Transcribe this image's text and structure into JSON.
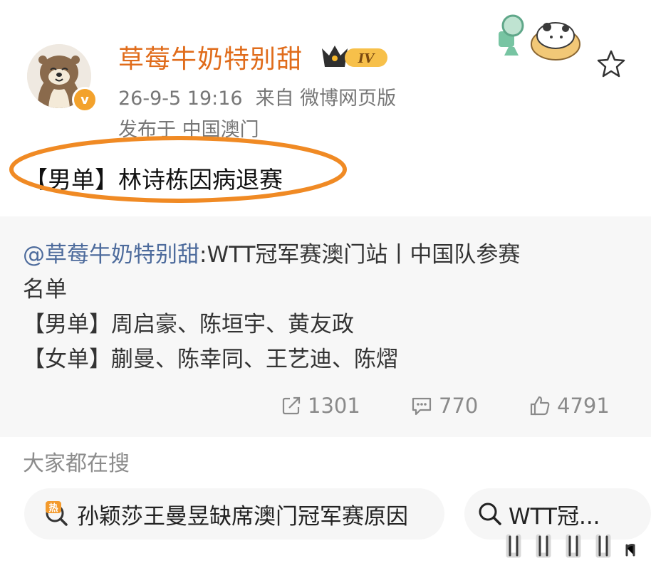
{
  "post": {
    "username": "草莓牛奶特别甜",
    "level_badge": "IV",
    "verified_badge": "v",
    "timestamp": "26-9-5 19:16",
    "source": "来自 微博网页版",
    "location": "发布于 中国澳门",
    "text": "【男单】林诗栋因病退赛",
    "favorite_icon": "star-icon"
  },
  "repost": {
    "mention": "@草莓牛奶特别甜",
    "line1_rest": ":WTT冠军赛澳门站丨中国队参赛",
    "line2": "名单",
    "line3": "【男单】周启豪、陈垣宇、黄友政",
    "line4": "【女单】蒯曼、陈幸同、王艺迪、陈熠"
  },
  "stats": {
    "reposts": "1301",
    "comments": "770",
    "likes": "4791"
  },
  "search": {
    "title": "大家都在搜",
    "hot_badge": "热",
    "items": [
      "孙颖莎王曼昱缺席澳门冠军赛原因",
      "WTT冠..."
    ]
  },
  "colors": {
    "username": "#e06c1b",
    "highlight": "#f08a24",
    "mention": "#4d6b9c",
    "muted": "#8a8a8a",
    "repost_bg": "#f7f7f7"
  }
}
